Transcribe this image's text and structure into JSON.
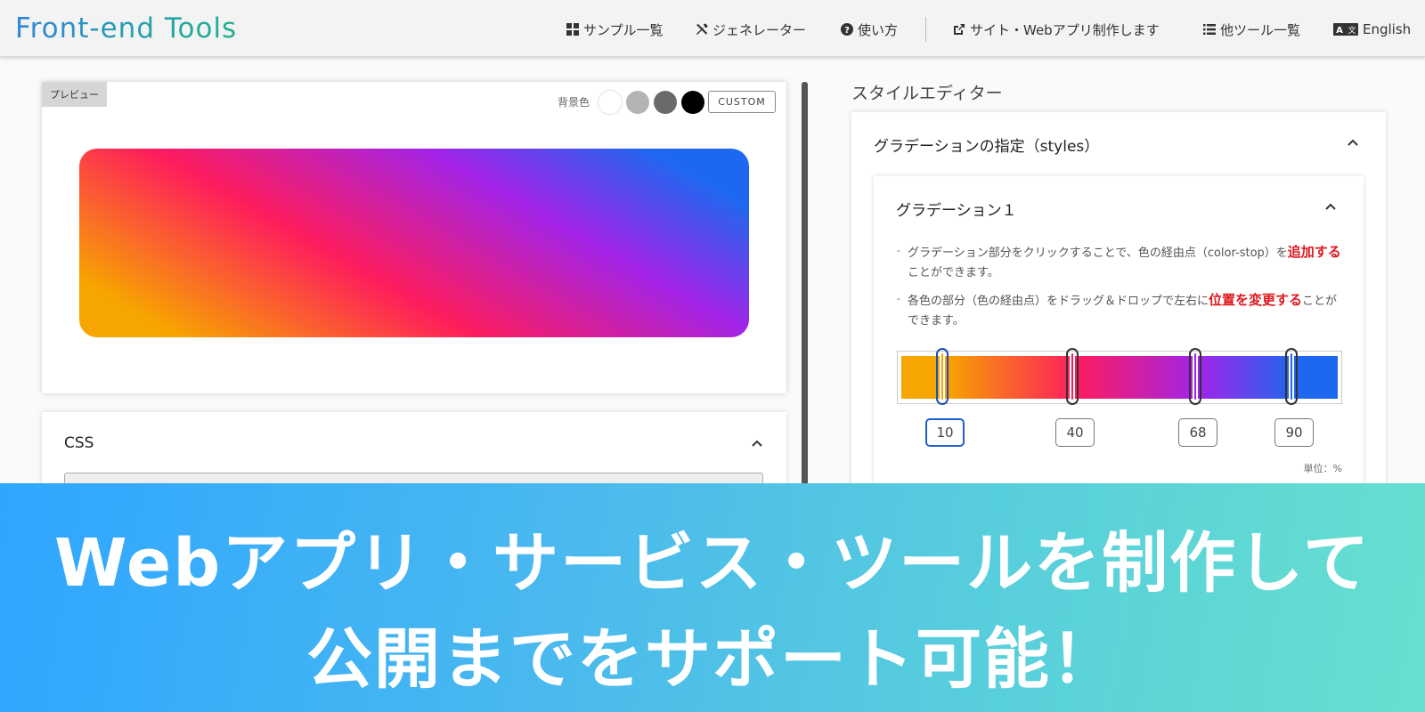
{
  "header": {
    "logo": "Front-end Tools",
    "nav": [
      {
        "label": "サンプル一覧",
        "icon": "grid-icon"
      },
      {
        "label": "ジェネレーター",
        "icon": "tools-icon"
      },
      {
        "label": "使い方",
        "icon": "question-circle-icon"
      },
      {
        "label": "サイト・Webアプリ制作します",
        "icon": "external-link-icon"
      },
      {
        "label": "他ツール一覧",
        "icon": "list-icon"
      },
      {
        "label": "English",
        "icon": "translate-icon"
      }
    ]
  },
  "preview": {
    "tag": "プレビュー",
    "bg_label": "背景色",
    "swatches": [
      "#ffffff",
      "#b4b4b4",
      "#6a6a6a",
      "#000000"
    ],
    "custom_label": "CUSTOM",
    "gradient_colors": [
      "#f7a500",
      "#fe1c5d",
      "#a224e8",
      "#1e68ef"
    ]
  },
  "css_panel": {
    "title": "CSS"
  },
  "editor": {
    "title": "スタイルエディター",
    "styles_card_title": "グラデーションの指定（styles）",
    "gradient_card_title": "グラデーション１",
    "notes": [
      {
        "before": "グラデーション部分をクリックすることで、色の経由点（color-stop）を",
        "highlight": "追加する",
        "after": "ことができます。"
      },
      {
        "before": "各色の部分（色の経由点）をドラッグ＆ドロップで左右に",
        "highlight": "位置を変更する",
        "after": "ことができます。"
      }
    ],
    "stops": [
      "10",
      "40",
      "68",
      "90"
    ],
    "unit": "単位：%"
  },
  "banner": {
    "line1": "Webアプリ・サービス・ツールを制作して",
    "line2": "公開までをサポート可能！"
  }
}
